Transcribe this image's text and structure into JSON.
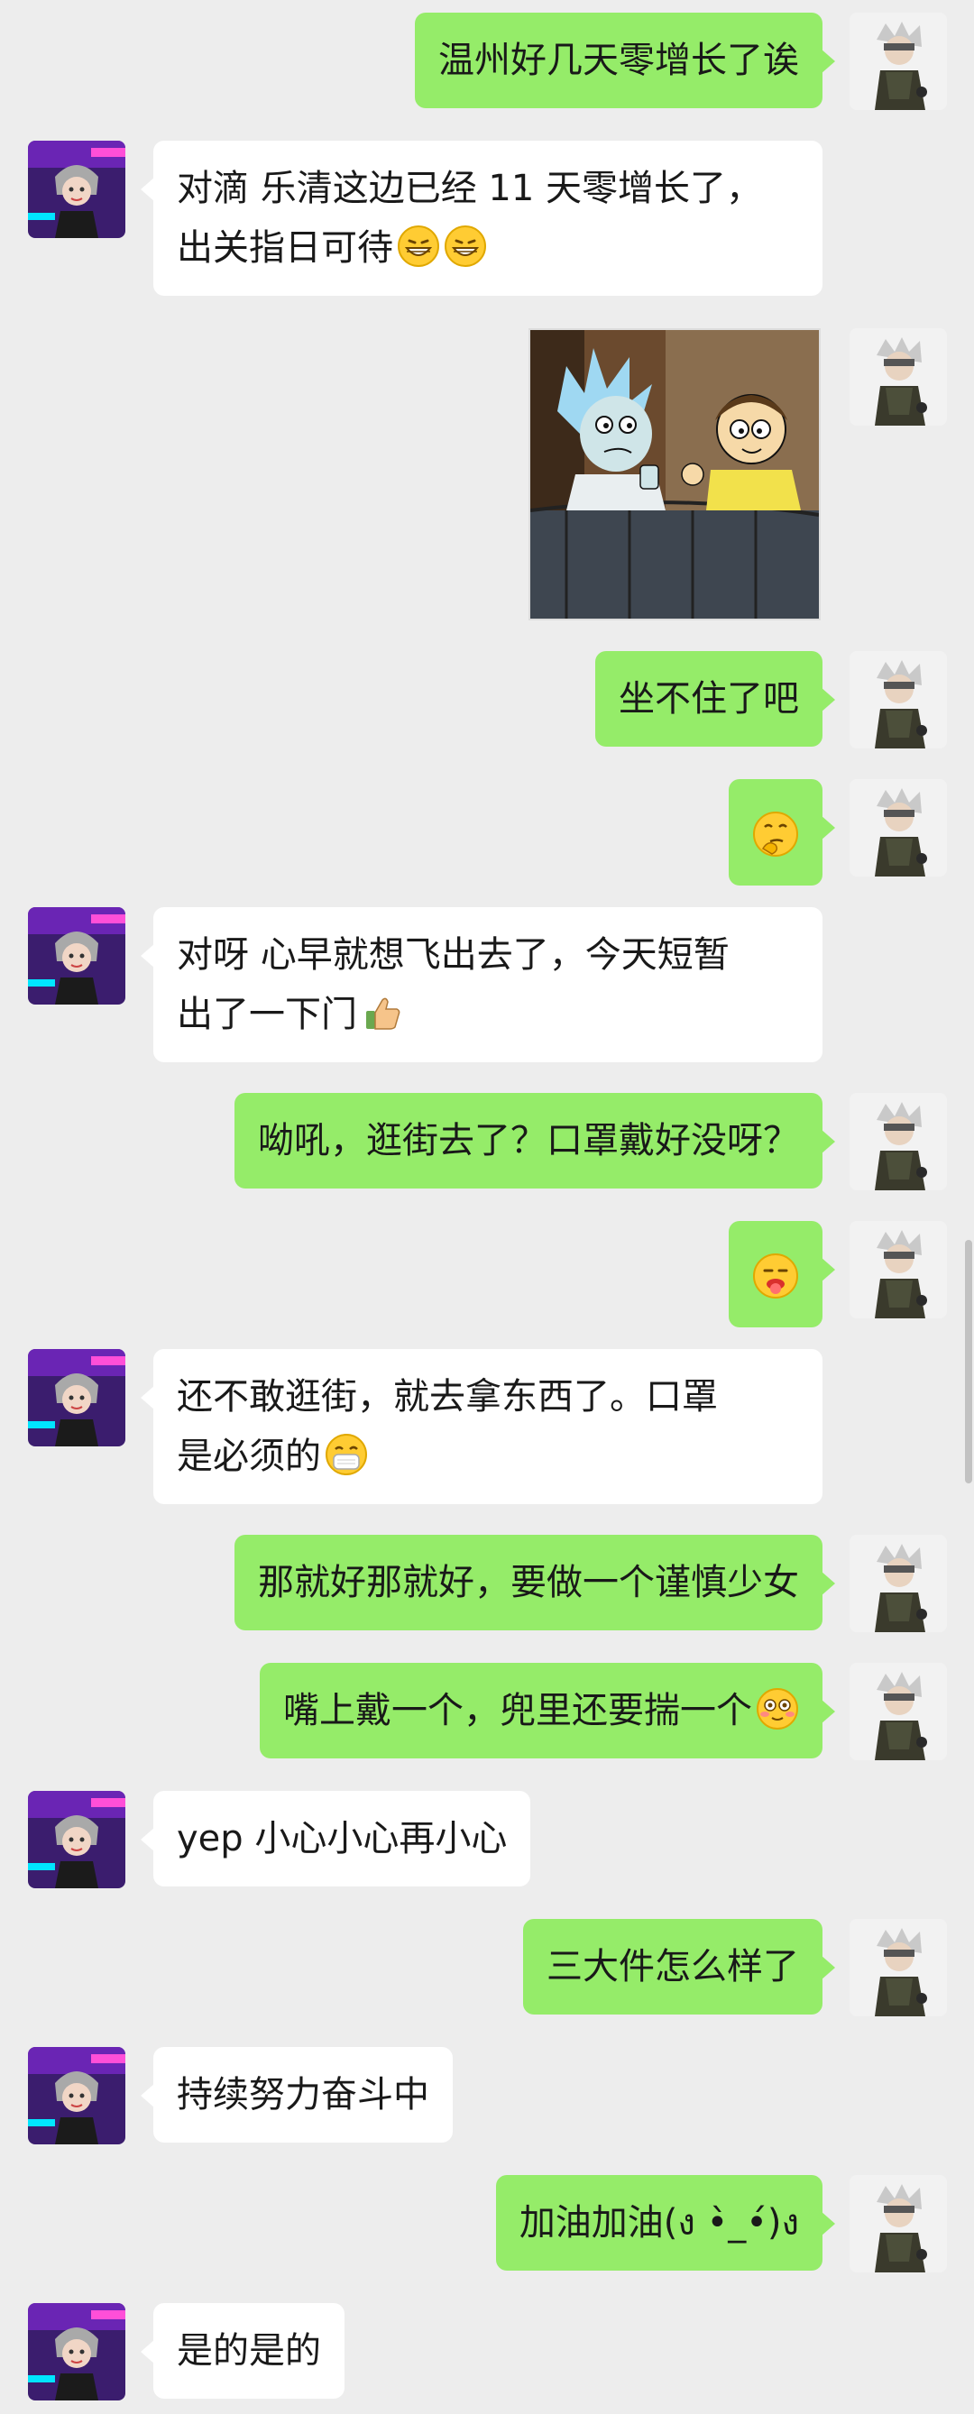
{
  "messages": [
    {
      "side": "me",
      "text": "温州好几天零增长了诶"
    },
    {
      "side": "them",
      "line1": "对滴 乐清这边已经 11 天零增长了，",
      "line2": "出关指日可待",
      "emoji": "grin-icon"
    },
    {
      "side": "me",
      "kind": "image",
      "image": "cartoon-sticker-image"
    },
    {
      "side": "me",
      "text": "坐不住了吧"
    },
    {
      "side": "me",
      "kind": "emoji",
      "emoji": "thinking-face-icon"
    },
    {
      "side": "them",
      "line1": "对呀 心早就想飞出去了，今天短暂",
      "line2": "出了一下门",
      "emoji": "thumbs-up-icon"
    },
    {
      "side": "me",
      "text": "呦吼，逛街去了？口罩戴好没呀？"
    },
    {
      "side": "me",
      "kind": "emoji",
      "emoji": "sticking-tongue-icon"
    },
    {
      "side": "them",
      "line1": "还不敢逛街，就去拿东西了。口罩",
      "line2": "是必须的",
      "emoji": "mask-face-icon"
    },
    {
      "side": "me",
      "text": "那就好那就好，要做一个谨慎少女"
    },
    {
      "side": "me",
      "text": "嘴上戴一个，兜里还要揣一个",
      "emoji": "flushed-face-icon"
    },
    {
      "side": "them",
      "text": "yep 小心小心再小心"
    },
    {
      "side": "me",
      "text": "三大件怎么样了"
    },
    {
      "side": "them",
      "text": "持续努力奋斗中"
    },
    {
      "side": "me",
      "text": "加油加油(ง •̀_•́)ง"
    },
    {
      "side": "them",
      "text": "是的是的"
    }
  ],
  "colors": {
    "background": "#ededed",
    "me_bubble": "#95ec69",
    "them_bubble": "#ffffff",
    "text": "#191919"
  },
  "avatars": {
    "me": "kakashi-avatar",
    "them": "girl-avatar"
  }
}
